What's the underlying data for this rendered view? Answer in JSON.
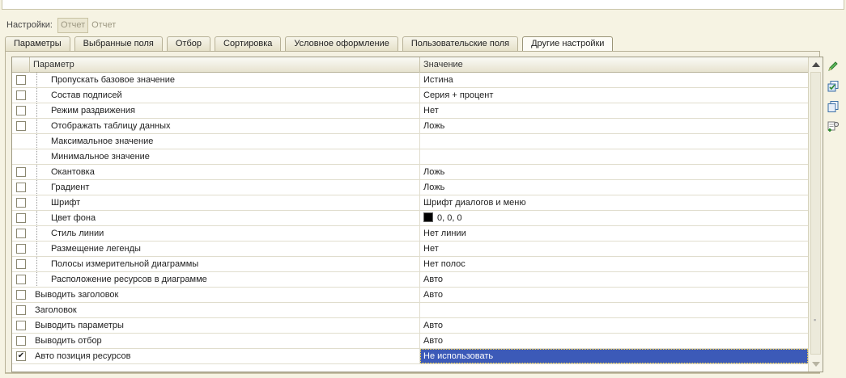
{
  "settings_bar": {
    "label": "Настройки:",
    "button_label": "Отчет",
    "link_label": "Отчет"
  },
  "tabs": [
    {
      "label": "Параметры"
    },
    {
      "label": "Выбранные поля"
    },
    {
      "label": "Отбор"
    },
    {
      "label": "Сортировка"
    },
    {
      "label": "Условное оформление"
    },
    {
      "label": "Пользовательские поля"
    },
    {
      "label": "Другие настройки"
    }
  ],
  "active_tab": "Другие настройки",
  "grid": {
    "columns": {
      "parameter": "Параметр",
      "value": "Значение"
    },
    "rows": [
      {
        "checked": false,
        "level": "child",
        "parameter": "Пропускать базовое значение",
        "value": "Истина"
      },
      {
        "checked": false,
        "level": "child",
        "parameter": "Состав подписей",
        "value": "Серия + процент"
      },
      {
        "checked": false,
        "level": "child",
        "parameter": "Режим раздвижения",
        "value": "Нет"
      },
      {
        "checked": false,
        "level": "child",
        "parameter": "Отображать таблицу данных",
        "value": "Ложь"
      },
      {
        "checked": null,
        "level": "child",
        "parameter": "Максимальное значение",
        "value": ""
      },
      {
        "checked": null,
        "level": "child",
        "parameter": "Минимальное значение",
        "value": ""
      },
      {
        "checked": false,
        "level": "child",
        "parameter": "Окантовка",
        "value": "Ложь"
      },
      {
        "checked": false,
        "level": "child",
        "parameter": "Градиент",
        "value": "Ложь"
      },
      {
        "checked": false,
        "level": "child",
        "parameter": "Шрифт",
        "value": "Шрифт диалогов и меню"
      },
      {
        "checked": false,
        "level": "child",
        "parameter": "Цвет фона",
        "value": "0, 0, 0",
        "swatch_color": "#000000"
      },
      {
        "checked": false,
        "level": "child",
        "parameter": "Стиль линии",
        "value": "Нет линии"
      },
      {
        "checked": false,
        "level": "child",
        "parameter": "Размещение легенды",
        "value": "Нет"
      },
      {
        "checked": false,
        "level": "child",
        "parameter": "Полосы измерительной диаграммы",
        "value": "Нет полос"
      },
      {
        "checked": false,
        "level": "child",
        "parameter": "Расположение ресурсов в диаграмме",
        "value": "Авто"
      },
      {
        "checked": false,
        "level": "top",
        "parameter": "Выводить заголовок",
        "value": "Авто"
      },
      {
        "checked": false,
        "level": "top",
        "parameter": "Заголовок",
        "value": ""
      },
      {
        "checked": false,
        "level": "top",
        "parameter": "Выводить параметры",
        "value": "Авто"
      },
      {
        "checked": false,
        "level": "top",
        "parameter": "Выводить отбор",
        "value": "Авто"
      },
      {
        "checked": true,
        "level": "top",
        "parameter": "Авто позиция ресурсов",
        "value": "Не использовать",
        "selected": true
      }
    ]
  },
  "sidebar_icons": [
    "edit-pencil-icon",
    "copy-settings-icon",
    "copy-icon",
    "add-field-icon"
  ],
  "colors": {
    "selection": "#3c5ab8",
    "background": "#f6f3e3"
  }
}
